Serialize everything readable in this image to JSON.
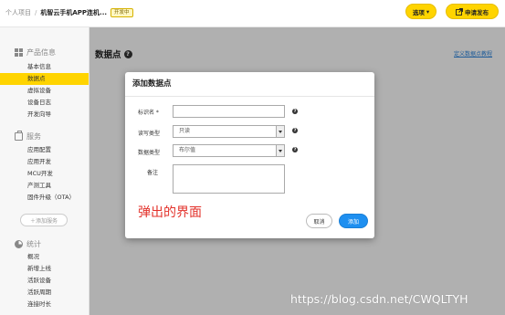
{
  "topbar": {
    "breadcrumb_root": "个人项目",
    "breadcrumb_sep": "/",
    "breadcrumb_current": "机智云手机APP连机...",
    "badge": "开发中",
    "select_label": "选项",
    "select_chevron": "▾",
    "apply_label": "申请发布"
  },
  "sidebar": {
    "sections": [
      {
        "icon": "grid-icon",
        "title": "产品信息",
        "items": [
          "基本信息",
          "数据点",
          "虚拟设备",
          "设备日志",
          "开发向导"
        ]
      },
      {
        "icon": "briefcase-icon",
        "title": "服务",
        "items": [
          "应用配置",
          "应用开发",
          "MCU开发",
          "产测工具",
          "固件升级（OTA）"
        ]
      },
      {
        "icon": "pie-chart-icon",
        "title": "统计",
        "items": [
          "概况",
          "新增上线",
          "活跃设备",
          "活跃周期",
          "连接时长"
        ]
      }
    ],
    "active_item": "数据点",
    "add_service_label": "＋添加服务"
  },
  "main": {
    "page_title": "数据点",
    "help_glyph": "?",
    "define_link": "定义数据点教程"
  },
  "modal": {
    "title": "添加数据点",
    "fields": {
      "identifier_label": "标识名 *",
      "identifier_value": "",
      "rw_label": "读写类型",
      "rw_value": "只读",
      "datatype_label": "数据类型",
      "datatype_value": "布尔值",
      "remark_label": "备注",
      "remark_value": ""
    },
    "help_glyph": "?",
    "cancel_label": "取消",
    "add_label": "添加"
  },
  "annotation": "弹出的界面",
  "watermark": "https://blog.csdn.net/CWQLTYH",
  "colors": {
    "accent": "#ffd400",
    "primary_button": "#1e8ff0",
    "annotation": "#e3322b",
    "link": "#2a7fd4"
  }
}
